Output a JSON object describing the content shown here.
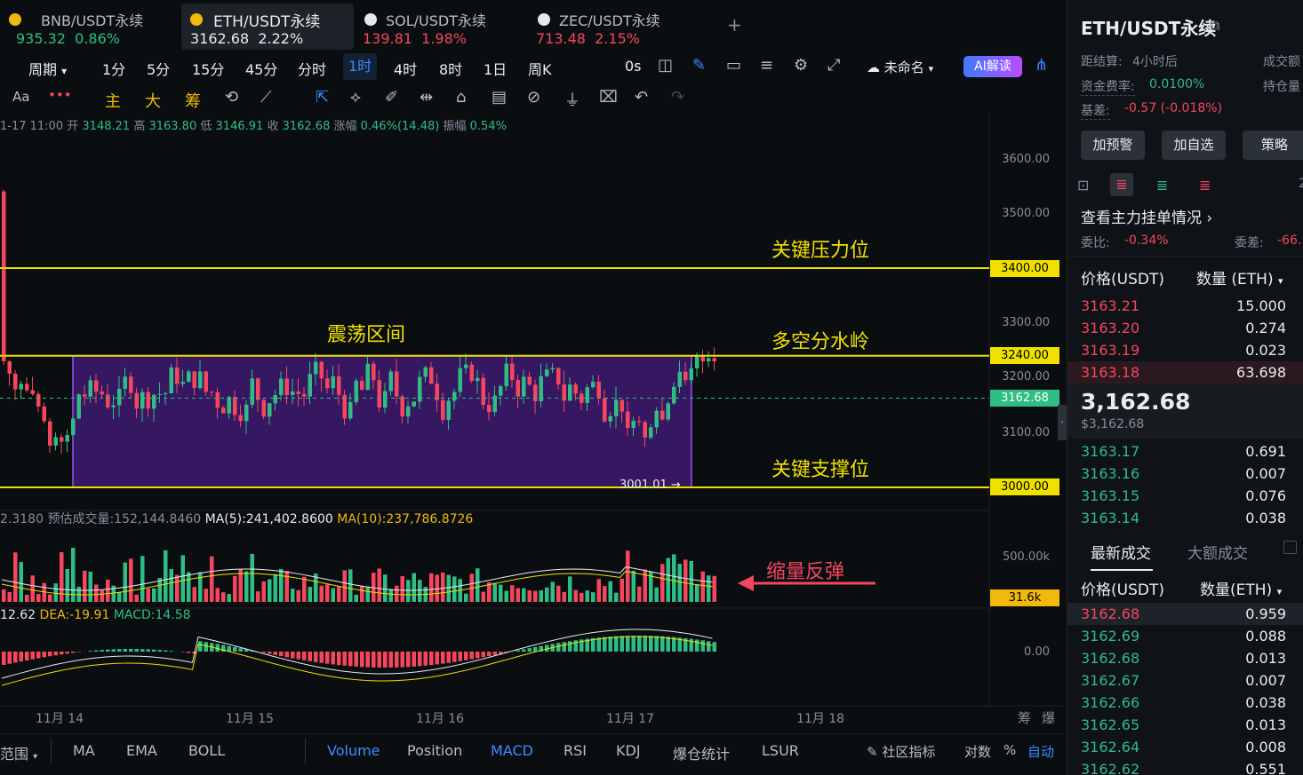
{
  "tabs": [
    {
      "name": "BNB/USDT永续",
      "price": "935.32",
      "change": "0.86%",
      "dir": "green",
      "coin": "bnb"
    },
    {
      "name": "ETH/USDT永续",
      "price": "3162.68",
      "change": "2.22%",
      "dir": "green",
      "coin": "eth"
    },
    {
      "name": "SOL/USDT永续",
      "price": "139.81",
      "change": "1.98%",
      "dir": "red",
      "coin": "sol"
    },
    {
      "name": "ZEC/USDT永续",
      "price": "713.48",
      "change": "2.15%",
      "dir": "red",
      "coin": "zec"
    }
  ],
  "add_tab": "+",
  "toolbar": {
    "period": "周期",
    "timeframes": [
      "1分",
      "5分",
      "15分",
      "45分",
      "分时",
      "1时",
      "4时",
      "8时",
      "1日",
      "周K"
    ],
    "selected": "1时",
    "countdown": "0s",
    "layout_name": "未命名",
    "ai": "AI解读"
  },
  "draw_toolbar": {
    "aa": "Aa",
    "zhu": "主",
    "da": "大",
    "chou": "筹"
  },
  "ohlc": {
    "time": "1-17 11:00",
    "open_l": "开",
    "open": "3148.21",
    "high_l": "高",
    "high": "3163.80",
    "low_l": "低",
    "low": "3146.91",
    "close_l": "收",
    "close": "3162.68",
    "chg_l": "涨幅",
    "chg": "0.46%(14.48)",
    "amp_l": "振幅",
    "amp": "0.54%"
  },
  "price_axis": [
    "3600.00",
    "3500.00",
    "3300.00",
    "3200.00",
    "3100.00"
  ],
  "levels": [
    {
      "price": "3400.00",
      "label": "关键压力位"
    },
    {
      "price": "3240.00",
      "label": "多空分水岭"
    },
    {
      "price": "3000.00",
      "label": "关键支撑位"
    }
  ],
  "current_price": "3162.68",
  "range_label": "震荡区间",
  "low_marker": "3001.01",
  "volume": {
    "prefix": "2.3180",
    "est": "预估成交量:152,144.8460",
    "ma5": "MA(5):241,402.8600",
    "ma10": "MA(10):237,786.8726",
    "axis": "500.00k",
    "tag": "31.6k",
    "note": "缩量反弹"
  },
  "macd": {
    "dif": "12.62",
    "dea": "DEA:-19.91",
    "macd": "MACD:14.58",
    "axis": "0.00"
  },
  "dates": [
    "11月 14",
    "11月 15",
    "11月 16",
    "11月 17",
    "11月 18"
  ],
  "corner": {
    "a": "筹",
    "b": "爆"
  },
  "bottom": {
    "range": "范围",
    "items": [
      "MA",
      "EMA",
      "BOLL",
      "Volume",
      "Position",
      "MACD",
      "RSI",
      "KDJ",
      "爆仓统计",
      "LSUR"
    ],
    "community": "社区指标",
    "log": "对数",
    "pct": "%",
    "auto": "自动"
  },
  "right": {
    "title": "ETH/USDT永续",
    "settle_l": "距结算:",
    "settle": "4小时后",
    "vol_l": "成交额",
    "funding_l": "资金费率:",
    "funding": "0.0100%",
    "oi_l": "持仓量",
    "basis_l": "基差:",
    "basis": "-0.57 (-0.018%)",
    "buttons": [
      "加预警",
      "加自选",
      "策略"
    ],
    "depth_num": "2",
    "orders_link": "查看主力挂单情况",
    "ratio_l": "委比:",
    "ratio": "-0.34%",
    "diff_l": "委差:",
    "diff": "-66.",
    "col_price": "价格(USDT)",
    "col_qty": "数量 (ETH)",
    "asks": [
      [
        "3163.21",
        "15.000"
      ],
      [
        "3163.20",
        "0.274"
      ],
      [
        "3163.19",
        "0.023"
      ],
      [
        "3163.18",
        "63.698"
      ]
    ],
    "last": "3,162.68",
    "last_usd": "$3,162.68",
    "bids": [
      [
        "3163.17",
        "0.691"
      ],
      [
        "3163.16",
        "0.007"
      ],
      [
        "3163.15",
        "0.076"
      ],
      [
        "3163.14",
        "0.038"
      ]
    ],
    "trades_tab": "最新成交",
    "big_tab": "大额成交",
    "col_price2": "价格(USDT)",
    "col_qty2": "数量(ETH)",
    "trades": [
      [
        "3162.68",
        "0.959",
        "red"
      ],
      [
        "3162.69",
        "0.088",
        "green"
      ],
      [
        "3162.68",
        "0.013",
        "green"
      ],
      [
        "3162.67",
        "0.007",
        "green"
      ],
      [
        "3162.66",
        "0.038",
        "green"
      ],
      [
        "3162.65",
        "0.013",
        "green"
      ],
      [
        "3162.64",
        "0.008",
        "green"
      ],
      [
        "3162.62",
        "0.551",
        "green"
      ]
    ]
  },
  "colors": {
    "up": "#2ebd85",
    "down": "#f6465d",
    "accent": "#3d8bff",
    "level": "#f0e000",
    "range_fill": "#5b21a6"
  }
}
